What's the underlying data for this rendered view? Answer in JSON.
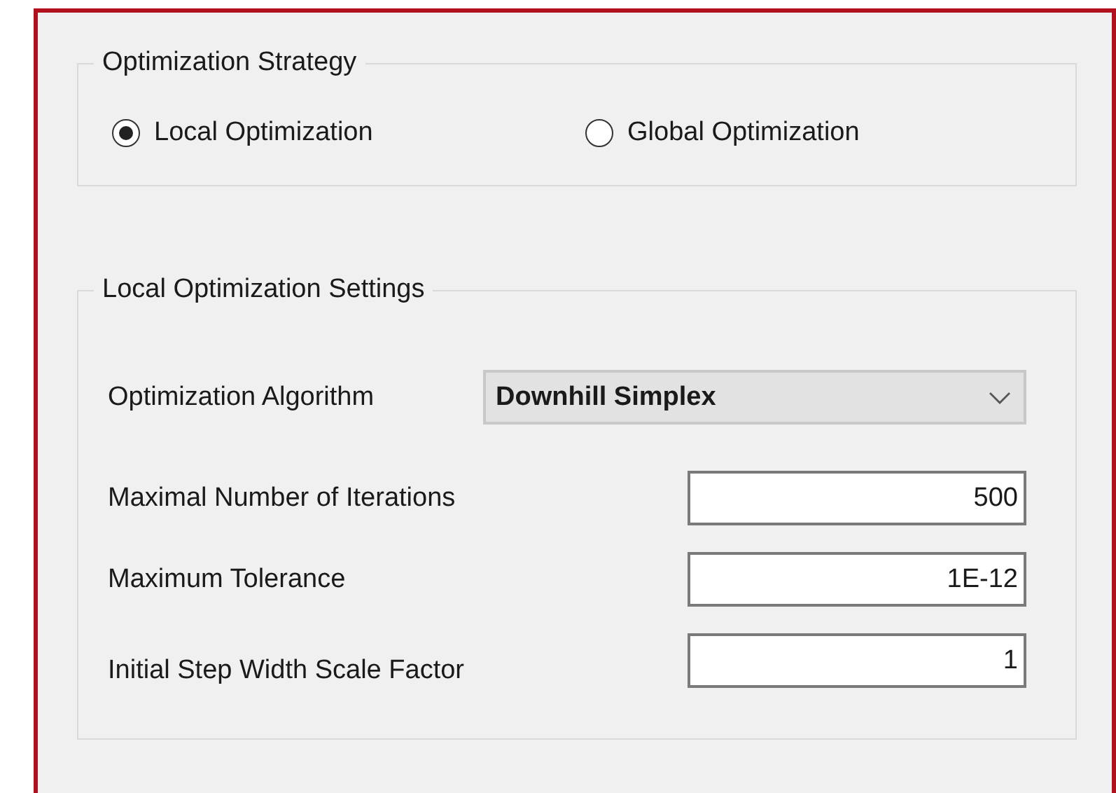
{
  "strategy": {
    "title": "Optimization Strategy",
    "options": [
      {
        "label": "Local Optimization",
        "selected": true
      },
      {
        "label": "Global Optimization",
        "selected": false
      }
    ]
  },
  "local_settings": {
    "title": "Local Optimization Settings",
    "algorithm": {
      "label": "Optimization Algorithm",
      "value": "Downhill Simplex"
    },
    "fields": [
      {
        "label": "Maximal Number of Iterations",
        "value": "500"
      },
      {
        "label": "Maximum Tolerance",
        "value": "1E-12"
      },
      {
        "label": "Initial Step Width Scale Factor",
        "value": "1"
      }
    ]
  }
}
